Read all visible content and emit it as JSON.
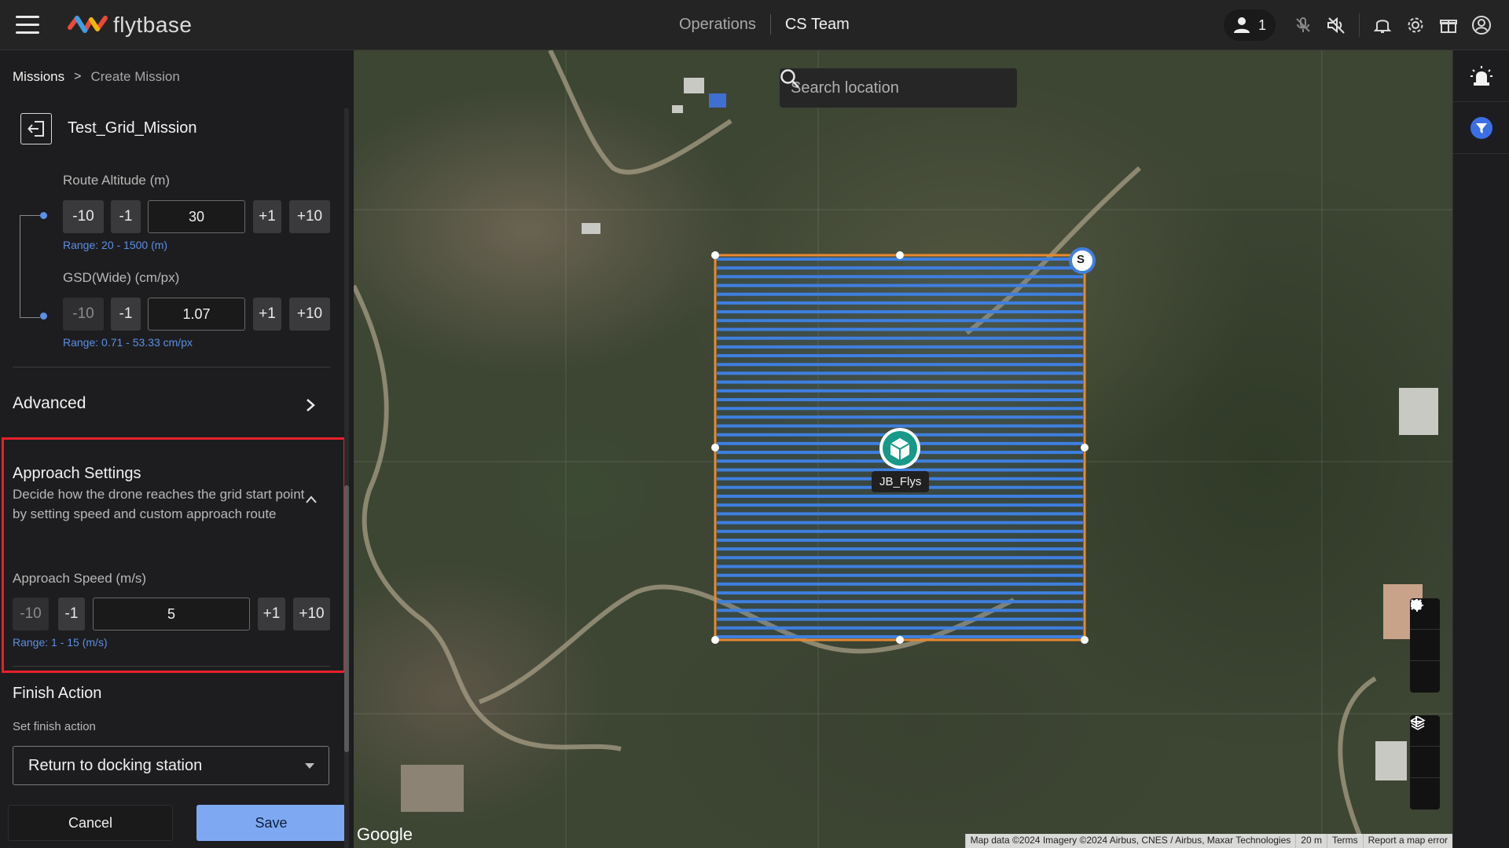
{
  "app": {
    "logo_text": "flytbase"
  },
  "nav": {
    "operations": "Operations",
    "team": "CS Team"
  },
  "topbar": {
    "users_count": "1"
  },
  "breadcrumb": {
    "root": "Missions",
    "current": "Create Mission"
  },
  "mission": {
    "name": "Test_Grid_Mission"
  },
  "route_altitude": {
    "label": "Route Altitude (m)",
    "value": "30",
    "range": "Range: 20 - 1500 (m)",
    "buttons": {
      "minus10": "-10",
      "minus1": "-1",
      "plus1": "+1",
      "plus10": "+10"
    }
  },
  "gsd": {
    "label": "GSD(Wide) (cm/px)",
    "value": "1.07",
    "range": "Range: 0.71 - 53.33 cm/px",
    "buttons": {
      "minus10": "-10",
      "minus1": "-1",
      "plus1": "+1",
      "plus10": "+10"
    }
  },
  "advanced": {
    "title": "Advanced"
  },
  "approach": {
    "title": "Approach Settings",
    "description": "Decide how the drone reaches the grid start point by setting speed and custom approach route",
    "speed_label": "Approach Speed (m/s)",
    "speed_value": "5",
    "range": "Range: 1 - 15 (m/s)",
    "buttons": {
      "minus10": "-10",
      "minus1": "-1",
      "plus1": "+1",
      "plus10": "+10"
    }
  },
  "finish": {
    "title": "Finish Action",
    "sub_label": "Set finish action",
    "selected": "Return to docking station"
  },
  "actions": {
    "cancel": "Cancel",
    "save": "Save"
  },
  "map": {
    "search_placeholder": "Search location",
    "start_marker": "S",
    "drone_label": "JB_Flys",
    "google": "Google",
    "attribution": [
      "Map data ©2024 Imagery ©2024 Airbus, CNES / Airbus, Maxar Technologies",
      "20 m",
      "Terms",
      "Report a map error"
    ]
  },
  "colors": {
    "accent": "#5c8fe6",
    "save_bg": "#7ea9f2",
    "highlight": "#e8202a",
    "grid_line": "#3f7fe0",
    "grid_border": "#e8892f",
    "drone": "#17998a"
  }
}
